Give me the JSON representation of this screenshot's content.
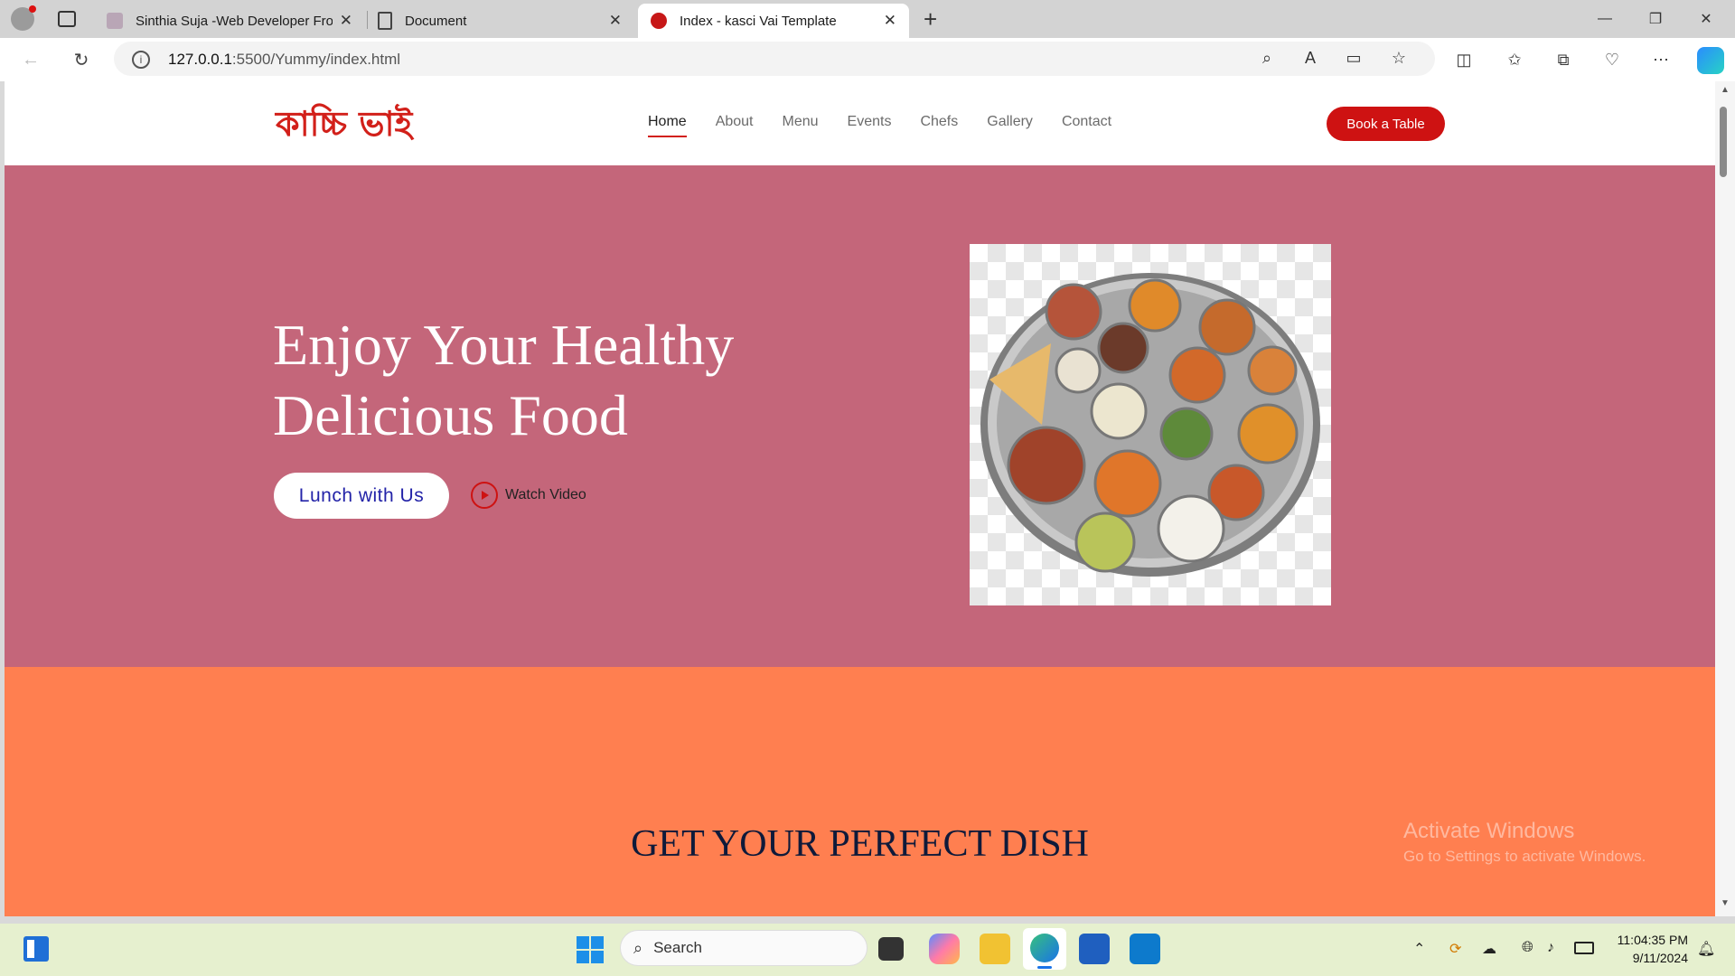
{
  "browser": {
    "tabs": [
      {
        "title": "Sinthia Suja -Web Developer Fron"
      },
      {
        "title": "Document"
      },
      {
        "title": "Index - kasci Vai Template"
      }
    ],
    "url_host": "127.0.0.1",
    "url_path": ":5500/Yummy/index.html"
  },
  "site": {
    "logo": "কাচ্চি ভাই",
    "nav": [
      "Home",
      "About",
      "Menu",
      "Events",
      "Chefs",
      "Gallery",
      "Contact"
    ],
    "book_button": "Book a Table",
    "hero": {
      "title_line1": "Enjoy Your Healthy",
      "title_line2": "Delicious Food",
      "cta": "Lunch with Us",
      "watch": "Watch Video"
    },
    "section_title": "GET YOUR PERFECT DISH"
  },
  "watermark": {
    "line1": "Activate Windows",
    "line2": "Go to Settings to activate Windows."
  },
  "taskbar": {
    "search": "Search",
    "time": "11:04:35 PM",
    "date": "9/11/2024"
  },
  "colors": {
    "accent": "#ce1212",
    "hero_bg": "#c4667a",
    "section_bg": "#ff7f50"
  }
}
